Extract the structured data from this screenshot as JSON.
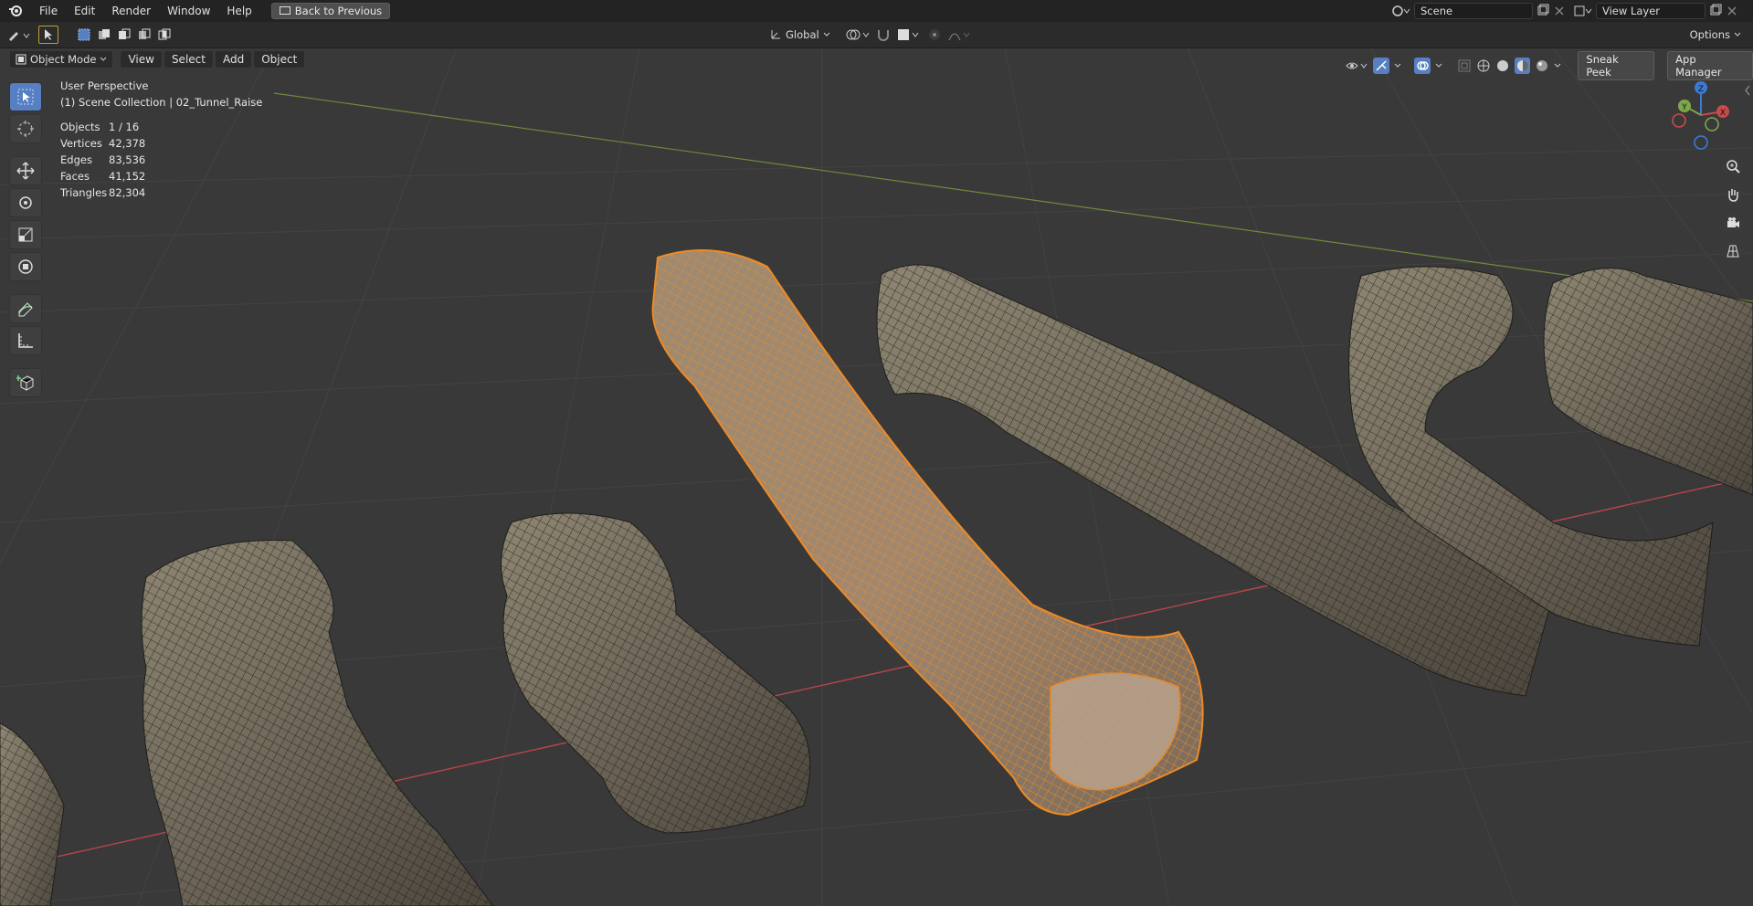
{
  "menu": {
    "items": [
      "File",
      "Edit",
      "Render",
      "Window",
      "Help"
    ],
    "back_button": "Back to Previous",
    "scene": "Scene",
    "view_layer": "View Layer"
  },
  "header": {
    "transform_orientation": "Global",
    "options": "Options"
  },
  "modebar": {
    "mode": "Object Mode",
    "menus": [
      "View",
      "Select",
      "Add",
      "Object"
    ],
    "sneak_peek": "Sneak Peek",
    "app_manager": "App Manager"
  },
  "viewport": {
    "perspective": "User Perspective",
    "collection": "(1) Scene Collection | 02_Tunnel_Raise",
    "stats": [
      {
        "label": "Objects",
        "value": "1 / 16"
      },
      {
        "label": "Vertices",
        "value": "42,378"
      },
      {
        "label": "Edges",
        "value": "83,536"
      },
      {
        "label": "Faces",
        "value": "41,152"
      },
      {
        "label": "Triangles",
        "value": "82,304"
      }
    ]
  },
  "gizmo": {
    "x": "X",
    "y": "Y",
    "z": "Z"
  },
  "colors": {
    "selection": "#f08a24",
    "x_axis": "#c94a4a",
    "y_axis": "#7ea64a",
    "z_axis": "#3a7bd5",
    "active_tool": "#5680c2",
    "viewport_bg": "#393939"
  }
}
